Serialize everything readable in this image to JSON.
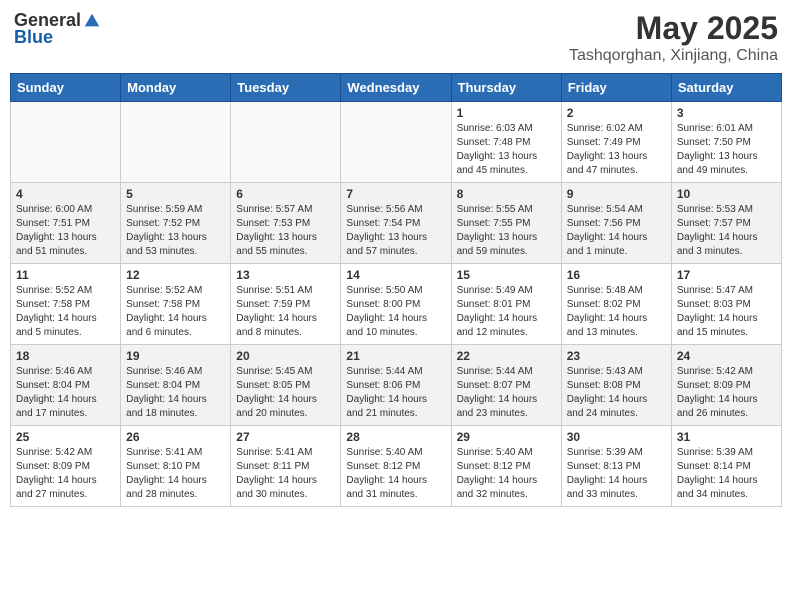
{
  "header": {
    "logo_general": "General",
    "logo_blue": "Blue",
    "month_year": "May 2025",
    "location": "Tashqorghan, Xinjiang, China"
  },
  "days_of_week": [
    "Sunday",
    "Monday",
    "Tuesday",
    "Wednesday",
    "Thursday",
    "Friday",
    "Saturday"
  ],
  "weeks": [
    [
      {
        "day": "",
        "info": ""
      },
      {
        "day": "",
        "info": ""
      },
      {
        "day": "",
        "info": ""
      },
      {
        "day": "",
        "info": ""
      },
      {
        "day": "1",
        "info": "Sunrise: 6:03 AM\nSunset: 7:48 PM\nDaylight: 13 hours\nand 45 minutes."
      },
      {
        "day": "2",
        "info": "Sunrise: 6:02 AM\nSunset: 7:49 PM\nDaylight: 13 hours\nand 47 minutes."
      },
      {
        "day": "3",
        "info": "Sunrise: 6:01 AM\nSunset: 7:50 PM\nDaylight: 13 hours\nand 49 minutes."
      }
    ],
    [
      {
        "day": "4",
        "info": "Sunrise: 6:00 AM\nSunset: 7:51 PM\nDaylight: 13 hours\nand 51 minutes."
      },
      {
        "day": "5",
        "info": "Sunrise: 5:59 AM\nSunset: 7:52 PM\nDaylight: 13 hours\nand 53 minutes."
      },
      {
        "day": "6",
        "info": "Sunrise: 5:57 AM\nSunset: 7:53 PM\nDaylight: 13 hours\nand 55 minutes."
      },
      {
        "day": "7",
        "info": "Sunrise: 5:56 AM\nSunset: 7:54 PM\nDaylight: 13 hours\nand 57 minutes."
      },
      {
        "day": "8",
        "info": "Sunrise: 5:55 AM\nSunset: 7:55 PM\nDaylight: 13 hours\nand 59 minutes."
      },
      {
        "day": "9",
        "info": "Sunrise: 5:54 AM\nSunset: 7:56 PM\nDaylight: 14 hours\nand 1 minute."
      },
      {
        "day": "10",
        "info": "Sunrise: 5:53 AM\nSunset: 7:57 PM\nDaylight: 14 hours\nand 3 minutes."
      }
    ],
    [
      {
        "day": "11",
        "info": "Sunrise: 5:52 AM\nSunset: 7:58 PM\nDaylight: 14 hours\nand 5 minutes."
      },
      {
        "day": "12",
        "info": "Sunrise: 5:52 AM\nSunset: 7:58 PM\nDaylight: 14 hours\nand 6 minutes."
      },
      {
        "day": "13",
        "info": "Sunrise: 5:51 AM\nSunset: 7:59 PM\nDaylight: 14 hours\nand 8 minutes."
      },
      {
        "day": "14",
        "info": "Sunrise: 5:50 AM\nSunset: 8:00 PM\nDaylight: 14 hours\nand 10 minutes."
      },
      {
        "day": "15",
        "info": "Sunrise: 5:49 AM\nSunset: 8:01 PM\nDaylight: 14 hours\nand 12 minutes."
      },
      {
        "day": "16",
        "info": "Sunrise: 5:48 AM\nSunset: 8:02 PM\nDaylight: 14 hours\nand 13 minutes."
      },
      {
        "day": "17",
        "info": "Sunrise: 5:47 AM\nSunset: 8:03 PM\nDaylight: 14 hours\nand 15 minutes."
      }
    ],
    [
      {
        "day": "18",
        "info": "Sunrise: 5:46 AM\nSunset: 8:04 PM\nDaylight: 14 hours\nand 17 minutes."
      },
      {
        "day": "19",
        "info": "Sunrise: 5:46 AM\nSunset: 8:04 PM\nDaylight: 14 hours\nand 18 minutes."
      },
      {
        "day": "20",
        "info": "Sunrise: 5:45 AM\nSunset: 8:05 PM\nDaylight: 14 hours\nand 20 minutes."
      },
      {
        "day": "21",
        "info": "Sunrise: 5:44 AM\nSunset: 8:06 PM\nDaylight: 14 hours\nand 21 minutes."
      },
      {
        "day": "22",
        "info": "Sunrise: 5:44 AM\nSunset: 8:07 PM\nDaylight: 14 hours\nand 23 minutes."
      },
      {
        "day": "23",
        "info": "Sunrise: 5:43 AM\nSunset: 8:08 PM\nDaylight: 14 hours\nand 24 minutes."
      },
      {
        "day": "24",
        "info": "Sunrise: 5:42 AM\nSunset: 8:09 PM\nDaylight: 14 hours\nand 26 minutes."
      }
    ],
    [
      {
        "day": "25",
        "info": "Sunrise: 5:42 AM\nSunset: 8:09 PM\nDaylight: 14 hours\nand 27 minutes."
      },
      {
        "day": "26",
        "info": "Sunrise: 5:41 AM\nSunset: 8:10 PM\nDaylight: 14 hours\nand 28 minutes."
      },
      {
        "day": "27",
        "info": "Sunrise: 5:41 AM\nSunset: 8:11 PM\nDaylight: 14 hours\nand 30 minutes."
      },
      {
        "day": "28",
        "info": "Sunrise: 5:40 AM\nSunset: 8:12 PM\nDaylight: 14 hours\nand 31 minutes."
      },
      {
        "day": "29",
        "info": "Sunrise: 5:40 AM\nSunset: 8:12 PM\nDaylight: 14 hours\nand 32 minutes."
      },
      {
        "day": "30",
        "info": "Sunrise: 5:39 AM\nSunset: 8:13 PM\nDaylight: 14 hours\nand 33 minutes."
      },
      {
        "day": "31",
        "info": "Sunrise: 5:39 AM\nSunset: 8:14 PM\nDaylight: 14 hours\nand 34 minutes."
      }
    ]
  ]
}
